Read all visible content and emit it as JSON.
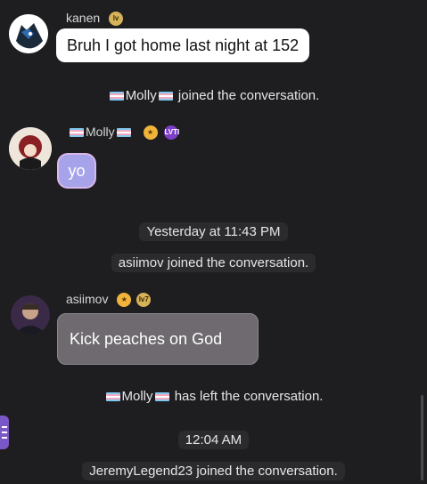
{
  "messages": [
    {
      "user": "kanen",
      "badge": "lv",
      "text": "Bruh I got home last night at 152"
    },
    {
      "user": "Molly",
      "badges": [
        "star",
        "LVTI"
      ],
      "text": "yo"
    },
    {
      "user": "asiimov",
      "badges": [
        "star",
        "lv7"
      ],
      "text": "Kick peaches on God"
    }
  ],
  "system": {
    "molly_joined": "joined the conversation.",
    "molly_name": "Molly",
    "timestamp1": "Yesterday at 11:43 PM",
    "asiimov_joined": "asiimov joined the conversation.",
    "molly_left": "has left the conversation.",
    "timestamp2": "12:04 AM",
    "jeremy_joined": "JeremyLegend23 joined the conversation."
  },
  "colors": {
    "background": "#1e1e20",
    "side_tab": "#7a57c6",
    "bubble_purple": "#a6a3ea",
    "bubble_grey": "#6e6a6f"
  }
}
